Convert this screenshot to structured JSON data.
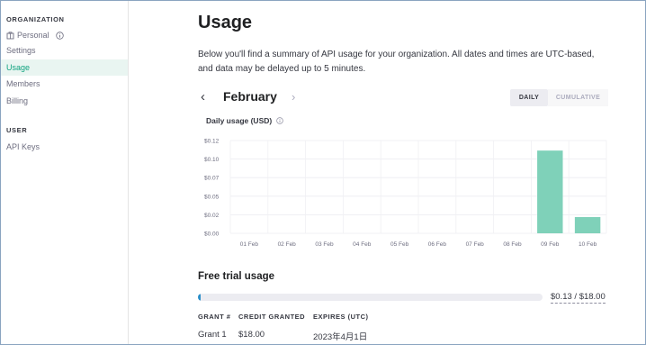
{
  "sidebar": {
    "org_section": "ORGANIZATION",
    "personal": "Personal",
    "items": [
      {
        "label": "Settings"
      },
      {
        "label": "Usage"
      },
      {
        "label": "Members"
      },
      {
        "label": "Billing"
      }
    ],
    "user_section": "USER",
    "user_items": [
      {
        "label": "API Keys"
      }
    ]
  },
  "main": {
    "title": "Usage",
    "description": "Below you'll find a summary of API usage for your organization. All dates and times are UTC-based, and data may be delayed up to 5 minutes.",
    "month": "February",
    "toggle": {
      "daily": "DAILY",
      "cumulative": "CUMULATIVE",
      "selected": "DAILY"
    },
    "chart_title": "Daily usage (USD)"
  },
  "chart_data": {
    "type": "bar",
    "title": "Daily usage (USD)",
    "categories": [
      "01 Feb",
      "02 Feb",
      "03 Feb",
      "04 Feb",
      "05 Feb",
      "06 Feb",
      "07 Feb",
      "08 Feb",
      "09 Feb",
      "10 Feb"
    ],
    "values": [
      0,
      0,
      0,
      0,
      0,
      0,
      0,
      0,
      0.107,
      0.021
    ],
    "yticks": [
      "$0.00",
      "$0.02",
      "$0.05",
      "$0.07",
      "$0.10",
      "$0.12"
    ],
    "ytick_values": [
      0,
      0.024,
      0.048,
      0.072,
      0.096,
      0.12
    ],
    "ylim": [
      0,
      0.12
    ],
    "bar_color": "#7fd1b9",
    "grid": true
  },
  "trial": {
    "title": "Free trial usage",
    "amount": "$0.13 / $18.00",
    "used_fraction": 0.0072,
    "bar_color": "#2a8fc9"
  },
  "grants": {
    "headers": [
      "GRANT #",
      "CREDIT GRANTED",
      "EXPIRES (UTC)"
    ],
    "rows": [
      [
        "Grant 1",
        "$18.00",
        "2023年4月1日"
      ]
    ]
  },
  "icons": {
    "personal": "building-icon",
    "info_personal": "info-icon",
    "info_chart": "info-icon",
    "prev_month": "chevron-left-icon",
    "next_month": "chevron-right-icon"
  }
}
